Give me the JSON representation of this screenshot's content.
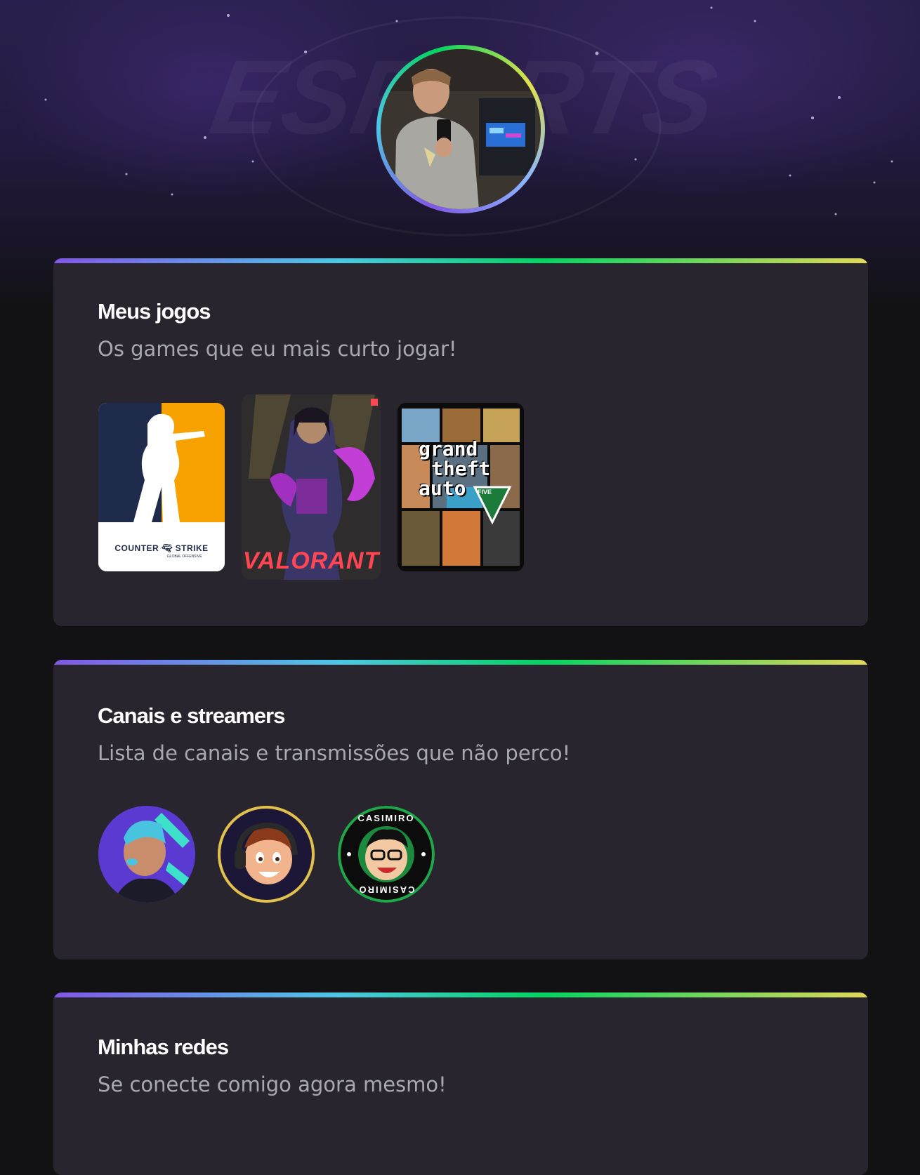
{
  "hero": {
    "watermark": "ESPORTS",
    "avatar_alt": "Foto de perfil"
  },
  "games_section": {
    "title": "Meus jogos",
    "subtitle": "Os games que eu mais curto jogar!",
    "games": [
      {
        "name": "Counter-Strike Global Offensive",
        "logo_left": "COUNTER",
        "logo_right": "STRIKE",
        "logo_small": "GLOBAL OFFENSIVE",
        "accent": "#f7a200"
      },
      {
        "name": "Valorant",
        "logo": "VALORANT",
        "accent": "#ff4655"
      },
      {
        "name": "Grand Theft Auto V",
        "logo_lines": [
          "grand",
          "theft",
          "auto"
        ],
        "logo_sub": "FIVE",
        "logo_num": "V"
      }
    ]
  },
  "streamers_section": {
    "title": "Canais e streamers",
    "subtitle": "Lista de canais e transmissões que não perco!",
    "streamers": [
      {
        "name": "streamer-1",
        "ring": "#5b3fc4"
      },
      {
        "name": "streamer-2",
        "ring": "#e1c14b"
      },
      {
        "name": "Casimiro",
        "top_text": "CASIMIRO",
        "bottom_text": "CASIMIRO",
        "ring": "#1fa84a"
      }
    ]
  },
  "socials_section": {
    "title": "Minhas redes",
    "subtitle": "Se conecte comigo agora mesmo!"
  }
}
